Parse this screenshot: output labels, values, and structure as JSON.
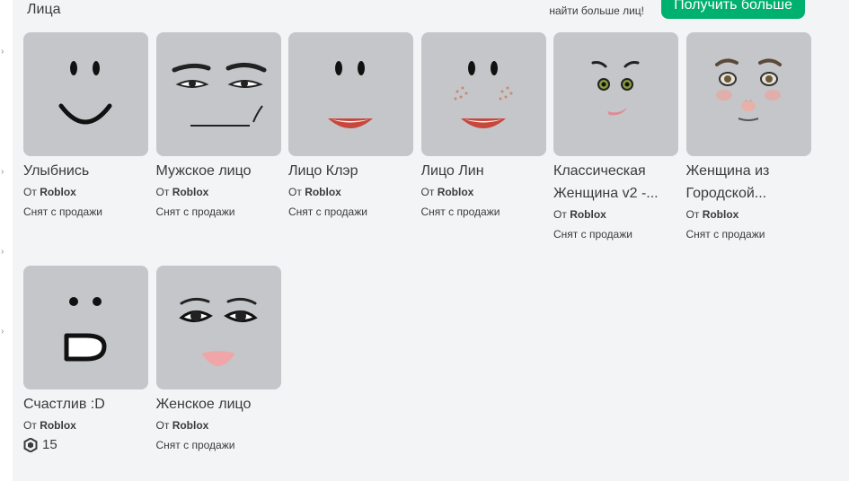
{
  "section": {
    "title": "Лица",
    "more_text": "найти больше лиц!",
    "get_more_label": "Получить больше"
  },
  "colors": {
    "accent": "#00b06f",
    "page_bg": "#f2f4f5",
    "thumb_bg": "#c5c6c9"
  },
  "items": [
    {
      "name": "Улыбнись",
      "by_prefix": "От",
      "creator": "Roblox",
      "status": "Снят с продажи",
      "icon": "smile-face-icon"
    },
    {
      "name": "Мужское лицо",
      "by_prefix": "От",
      "creator": "Roblox",
      "status": "Снят с продажи",
      "icon": "man-face-icon"
    },
    {
      "name": "Лицо Клэр",
      "by_prefix": "От",
      "creator": "Roblox",
      "status": "Снят с продажи",
      "icon": "claire-face-icon"
    },
    {
      "name": "Лицо Лин",
      "by_prefix": "От",
      "creator": "Roblox",
      "status": "Снят с продажи",
      "icon": "lin-face-icon"
    },
    {
      "name": "Классическая Женщина v2 -...",
      "by_prefix": "От",
      "creator": "Roblox",
      "status": "Снят с продажи",
      "icon": "classic-woman-face-icon"
    },
    {
      "name": "Женщина из Городской...",
      "by_prefix": "От",
      "creator": "Roblox",
      "status": "Снят с продажи",
      "icon": "city-woman-face-icon"
    },
    {
      "name": "Счастлив :D",
      "by_prefix": "От",
      "creator": "Roblox",
      "price": "15",
      "icon": "happy-d-face-icon"
    },
    {
      "name": "Женское лицо",
      "by_prefix": "От",
      "creator": "Roblox",
      "status": "Снят с продажи",
      "icon": "woman-face-icon"
    }
  ]
}
